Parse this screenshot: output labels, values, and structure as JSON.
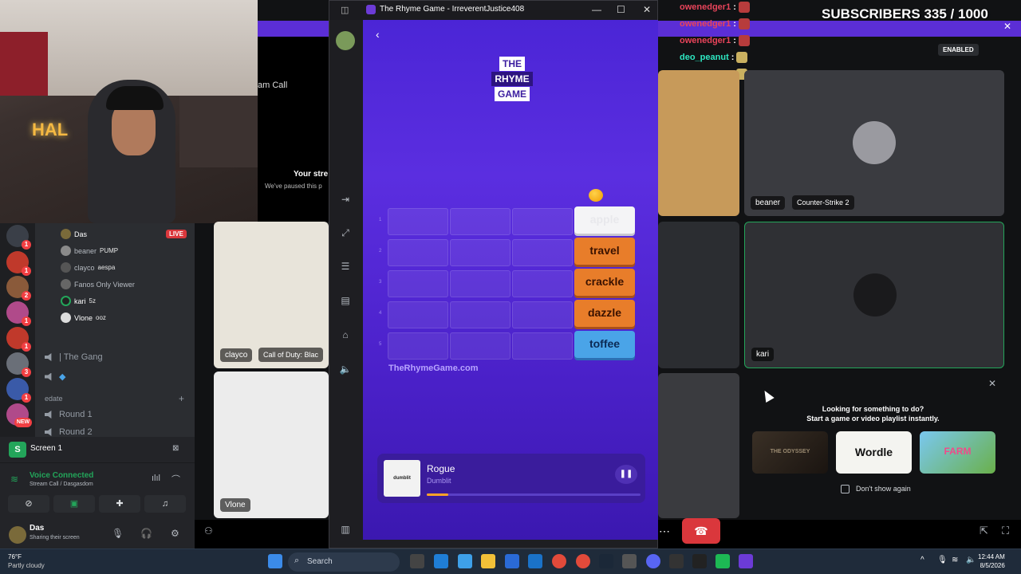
{
  "overlay": {
    "subscribers": "SUBSCRIBERS 335 / 1000",
    "chat": [
      {
        "user": "owenedger1",
        "color": "#e8445a"
      },
      {
        "user": "owenedger1",
        "color": "#e8445a"
      },
      {
        "user": "owenedger1",
        "color": "#e8445a"
      },
      {
        "user": "deo_peanut",
        "color": "#2ee6c1"
      },
      {
        "user": "deo_peanut",
        "color": "#2ee6c1"
      }
    ],
    "colon": ":"
  },
  "stream_call": {
    "label": "am Call",
    "paused_title": "Your stre",
    "paused_sub": "We've paused this p"
  },
  "servers": [
    {
      "badge": "1",
      "color": "#3a3f48"
    },
    {
      "badge": "1",
      "color": "#c0392b"
    },
    {
      "badge": "2",
      "color": "#8a5a3a"
    },
    {
      "badge": "1",
      "color": "#b04a8a"
    },
    {
      "badge": "1",
      "color": "#c0392b"
    },
    {
      "badge": "3",
      "color": "#6a6f78"
    },
    {
      "badge": "1",
      "color": "#3a5aa8"
    },
    {
      "badge": "NEW",
      "color": "#b04a8a"
    }
  ],
  "channel_list": {
    "users": [
      {
        "name": "Das",
        "tag": "",
        "color": "#ffffff"
      },
      {
        "name": "beaner",
        "tag": "PUMP",
        "color": "#b5bac1"
      },
      {
        "name": "clayco",
        "tag": "aespa",
        "color": "#b5bac1"
      },
      {
        "name": "Fanos Only Viewer",
        "tag": "",
        "color": "#b5bac1"
      },
      {
        "name": "kari",
        "tag": "5z",
        "color": "#ffffff"
      },
      {
        "name": "Vlone",
        "tag": "ooz",
        "color": "#ffffff"
      }
    ],
    "live": "LIVE",
    "gang": "| The Gang",
    "category": "edate",
    "round1": "Round 1",
    "round2": "Round 2"
  },
  "screen_bar": {
    "icon": "S",
    "label": "Screen 1"
  },
  "voice": {
    "status": "Voice Connected",
    "channel": "Stream Call / Dasgasdom"
  },
  "user": {
    "name": "Das",
    "status": "Sharing their screen"
  },
  "tiles": {
    "clayco_name": "clayco",
    "clayco_game": "Call of Duty: Blac",
    "vlone_name": "Vlone",
    "beaner_name": "beaner",
    "beaner_game": "Counter-Strike 2",
    "kari_name": "kari",
    "enabled": "ENABLED"
  },
  "activity": {
    "line1": "Looking for something to do?",
    "line2": "Start a game or video playlist instantly.",
    "cards": [
      "THE ODYSSEY",
      "Wordle",
      "FARM"
    ],
    "dont_show": "Don't show again"
  },
  "rhyme_window": {
    "title": "The Rhyme Game - IrreverentJustice408",
    "logo": [
      "THE",
      "RHYME",
      "GAME"
    ],
    "rows": [
      {
        "num": "1",
        "word": "apple",
        "style": "white"
      },
      {
        "num": "2",
        "word": "travel",
        "style": "orange"
      },
      {
        "num": "3",
        "word": "crackle",
        "style": "orange"
      },
      {
        "num": "4",
        "word": "dazzle",
        "style": "orange"
      },
      {
        "num": "5",
        "word": "toffee",
        "style": "blue"
      }
    ],
    "site": "TheRhymeGame.com",
    "player": {
      "art_label": "dumblit",
      "song": "Rogue",
      "artist": "Dumblit",
      "progress": 0.1
    }
  },
  "taskbar": {
    "temp": "76°F",
    "condition": "Partly cloudy",
    "search": "Search",
    "time": "12:44 AM",
    "date": "8/5/2026"
  }
}
